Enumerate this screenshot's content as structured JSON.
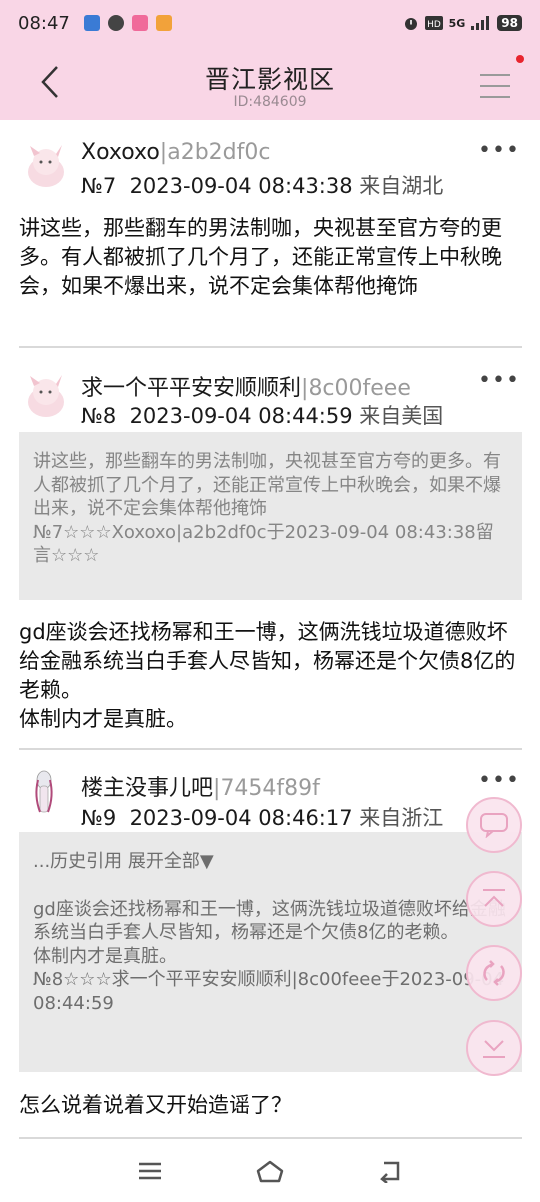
{
  "status_bar": {
    "time": "08:47",
    "network": "5G",
    "battery": "98",
    "colors": {
      "bg": "#f9d6e6"
    }
  },
  "header": {
    "title": "晋江影视区",
    "id_label": "ID:484609",
    "back_icon": "chevron-left-icon",
    "menu_icon": "hamburger-menu-icon"
  },
  "posts": [
    {
      "author": "Xoxoxo",
      "separator": "|",
      "user_id": "a2b2df0c",
      "floor": "№7",
      "datetime": "2023-09-04 08:43:38",
      "location": "来自湖北",
      "more": "•••",
      "body": "讲这些，那些翻车的男法制咖，央视甚至官方夸的更多。有人都被抓了几个月了，还能正常宣传上中秋晚会，如果不爆出来，说不定会集体帮他掩饰"
    },
    {
      "author": "求一个平平安安顺顺利",
      "separator": "|",
      "user_id": "8c00feee",
      "floor": "№8",
      "datetime": "2023-09-04 08:44:59",
      "location": "来自美国",
      "more": "•••",
      "quote_text": "讲这些，那些翻车的男法制咖，央视甚至官方夸的更多。有人都被抓了几个月了，还能正常宣传上中秋晚会，如果不爆出来，说不定会集体帮他掩饰",
      "quote_ref": "№7☆☆☆Xoxoxo|a2b2df0c于2023-09-04 08:43:38留言☆☆☆",
      "body_lines": [
        "gd座谈会还找杨幂和王一博，这俩洗钱垃圾道德败坏给金融系统当白手套人尽皆知，杨幂还是个欠债8亿的老赖。",
        "体制内才是真脏。"
      ]
    },
    {
      "author": "楼主没事儿吧",
      "separator": "|",
      "user_id": "7454f89f",
      "floor": "№9",
      "datetime": "2023-09-04 08:46:17",
      "location": "来自浙江",
      "more": "•••",
      "quote_expand": "...历史引用 展开全部▼",
      "quote_lines": [
        "gd座谈会还找杨幂和王一博，这俩洗钱垃圾道德败坏给金融系统当白手套人尽皆知，杨幂还是个欠债8亿的老赖。",
        "体制内才是真脏。"
      ],
      "quote_ref": "№8☆☆☆求一个平平安安顺顺利|8c00feee于2023-09-04 08:44:59",
      "body": "怎么说着说着又开始造谣了？"
    }
  ],
  "floating_buttons": [
    "comment-icon",
    "scroll-top-icon",
    "refresh-icon",
    "scroll-bottom-icon"
  ],
  "nav_bar": [
    "recent-apps-icon",
    "home-icon",
    "back-icon"
  ],
  "colors": {
    "header_bg": "#f9d6e6",
    "quote_bg": "#e9e9e9",
    "id_gray": "#9a9a9a",
    "accent_pink": "#f0b9cf"
  }
}
